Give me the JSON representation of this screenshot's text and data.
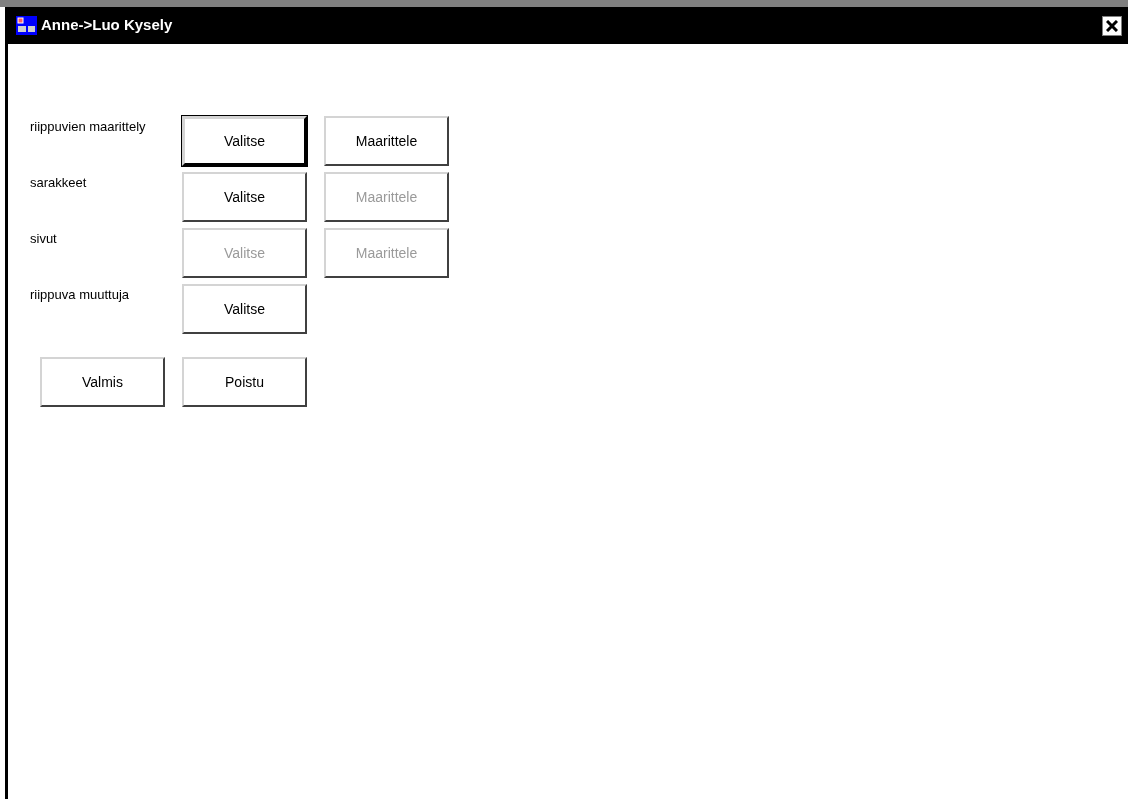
{
  "window": {
    "title": "Anne->Luo Kysely"
  },
  "rows": [
    {
      "label": "riippuvien maarittely",
      "buttons": [
        {
          "label": "Valitse",
          "disabled": false,
          "default": true
        },
        {
          "label": "Maarittele",
          "disabled": false,
          "default": false
        }
      ]
    },
    {
      "label": "sarakkeet",
      "buttons": [
        {
          "label": "Valitse",
          "disabled": false,
          "default": false
        },
        {
          "label": "Maarittele",
          "disabled": true,
          "default": false
        }
      ]
    },
    {
      "label": "sivut",
      "buttons": [
        {
          "label": "Valitse",
          "disabled": true,
          "default": false
        },
        {
          "label": "Maarittele",
          "disabled": true,
          "default": false
        }
      ]
    },
    {
      "label": "riippuva muuttuja",
      "buttons": [
        {
          "label": "Valitse",
          "disabled": false,
          "default": false
        }
      ]
    }
  ],
  "actions": [
    {
      "label": "Valmis",
      "disabled": false,
      "default": false
    },
    {
      "label": "Poistu",
      "disabled": false,
      "default": false
    }
  ]
}
